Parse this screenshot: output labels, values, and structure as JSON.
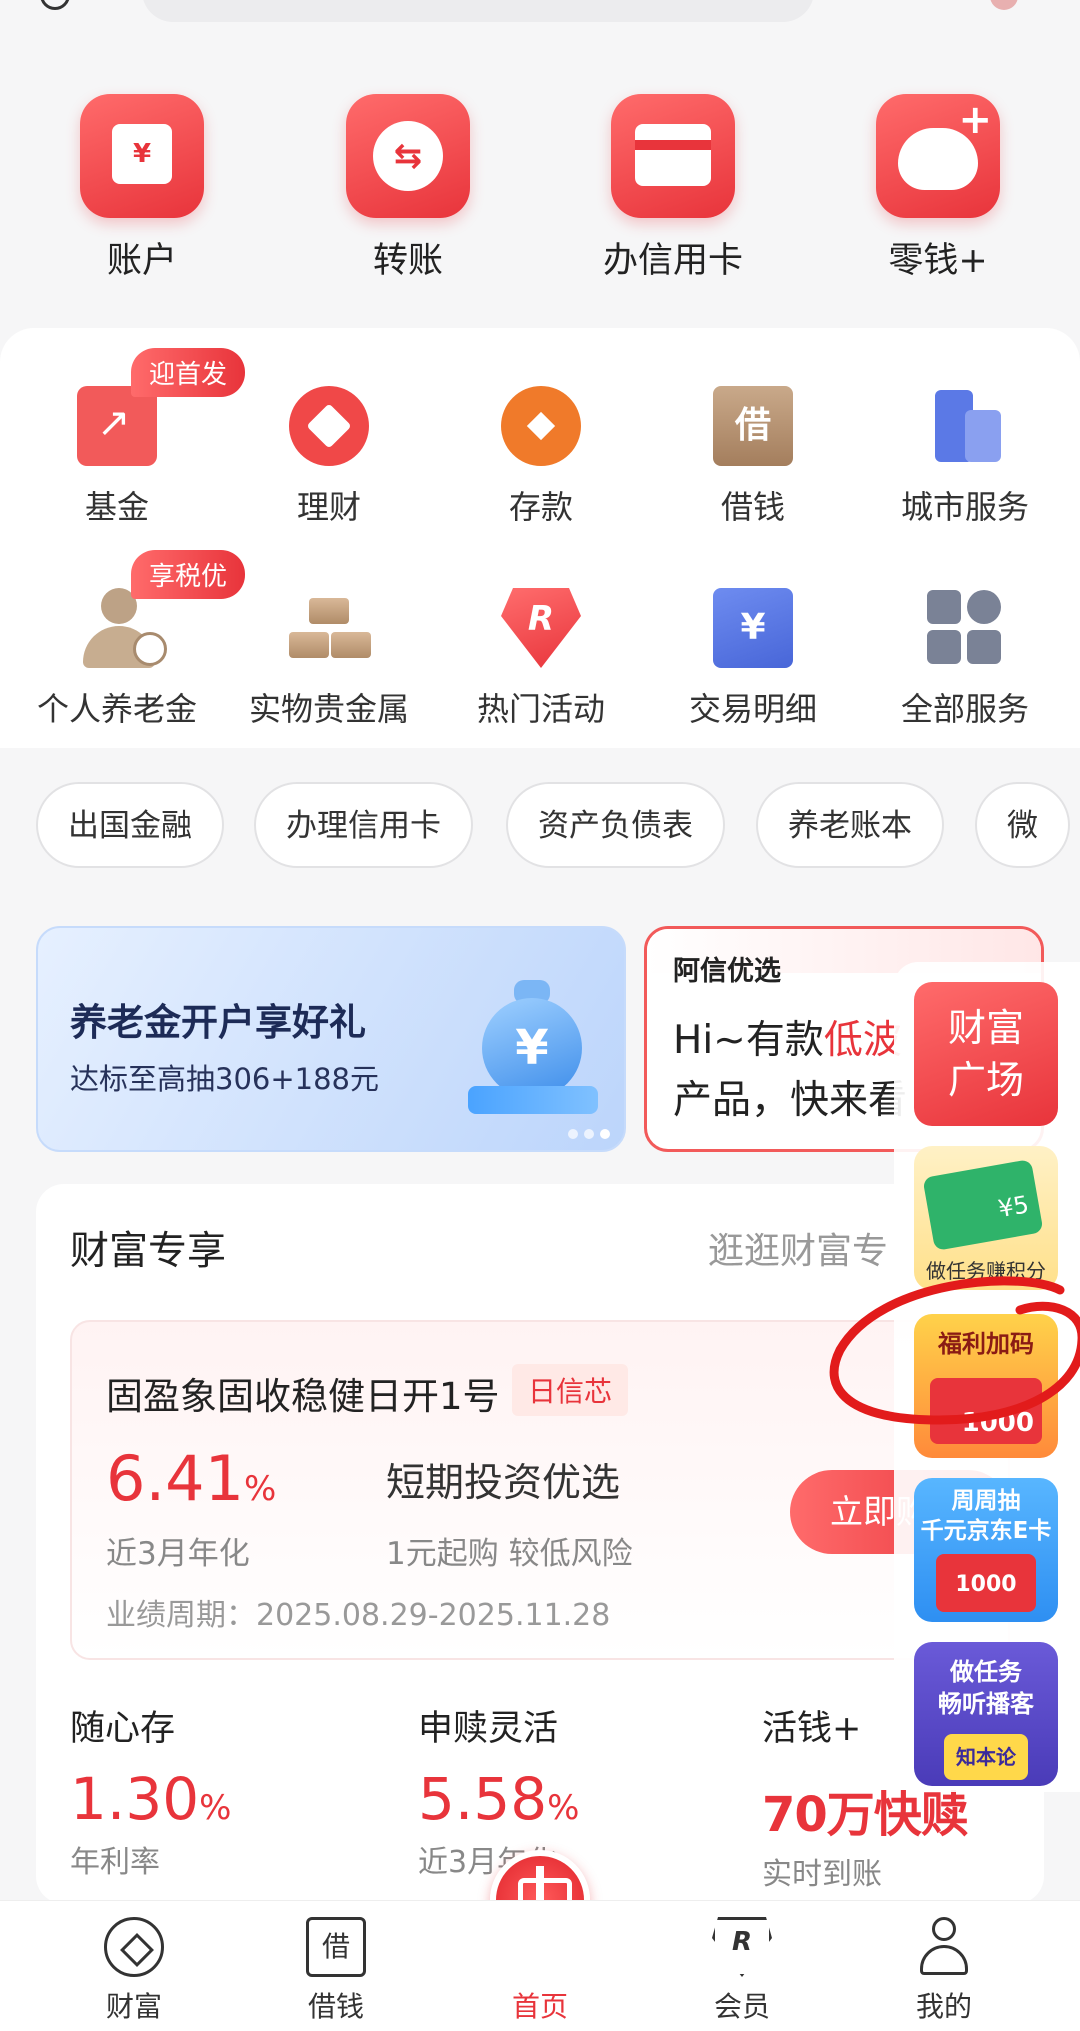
{
  "quick_actions": [
    {
      "label": "账户",
      "icon": "wallet-icon"
    },
    {
      "label": "转账",
      "icon": "transfer-icon"
    },
    {
      "label": "办信用卡",
      "icon": "credit-card-icon"
    },
    {
      "label": "零钱+",
      "icon": "piggy-bank-icon"
    }
  ],
  "services": [
    {
      "label": "基金",
      "icon": "fund-icon",
      "badge": "迎首发"
    },
    {
      "label": "理财",
      "icon": "wealth-management-icon"
    },
    {
      "label": "存款",
      "icon": "deposit-icon"
    },
    {
      "label": "借钱",
      "icon": "borrow-icon",
      "glyph": "借"
    },
    {
      "label": "城市服务",
      "icon": "city-service-icon"
    },
    {
      "label": "个人养老金",
      "icon": "pension-icon",
      "badge": "享税优"
    },
    {
      "label": "实物贵金属",
      "icon": "gold-bar-icon"
    },
    {
      "label": "热门活动",
      "icon": "hot-activity-icon",
      "glyph": "R"
    },
    {
      "label": "交易明细",
      "icon": "transaction-detail-icon",
      "glyph": "¥"
    },
    {
      "label": "全部服务",
      "icon": "all-services-icon"
    }
  ],
  "chips": [
    "出国金融",
    "办理信用卡",
    "资产负债表",
    "养老账本",
    "微"
  ],
  "banner_left": {
    "title": "养老金开户享好礼",
    "subtitle": "达标至高抽306+188元",
    "glyph": "¥"
  },
  "banner_right": {
    "brand": "阿信优选",
    "line1_prefix": "Hi~有款",
    "line1_highlight": "低波",
    "line2": "产品，快来看"
  },
  "wealth": {
    "title": "财富专享",
    "more": "逛逛财富专",
    "product": {
      "name": "固盈象固收稳健日开1号",
      "tag": "日信芯",
      "rate": "6.41",
      "rate_unit": "%",
      "rate_label": "近3月年化",
      "slogan": "短期投资优选",
      "desc": "1元起购 较低风险",
      "period": "业绩周期：2025.08.29-2025.11.28",
      "buy": "立即购买"
    },
    "minis": [
      {
        "title": "随心存",
        "value": "1.30",
        "unit": "%",
        "label": "年利率"
      },
      {
        "title": "申赎灵活",
        "value": "5.58",
        "unit": "%",
        "label": "近3月年化"
      },
      {
        "title": "活钱+",
        "value": "70万快赎",
        "unit": "",
        "label": "实时到账"
      }
    ]
  },
  "float_cards": [
    {
      "text": "财富\n广场"
    },
    {
      "text": "做任务赚积分",
      "card": "¥5"
    },
    {
      "title": "福利加码",
      "amount": "1000"
    },
    {
      "title": "周周抽\n千元京东E卡",
      "amount": "1000"
    },
    {
      "title": "做任务\n畅听播客",
      "badge": "知本论"
    }
  ],
  "bottom_nav": [
    {
      "label": "财富",
      "icon": "wealth-nav-icon"
    },
    {
      "label": "借钱",
      "icon": "borrow-nav-icon",
      "glyph": "借"
    },
    {
      "label": "首页",
      "icon": "home-logo-icon",
      "active": true
    },
    {
      "label": "会员",
      "icon": "member-nav-icon",
      "glyph": "R"
    },
    {
      "label": "我的",
      "icon": "profile-nav-icon"
    }
  ],
  "colors": {
    "brand_red": "#e8343b",
    "background": "#f6f6f7"
  }
}
